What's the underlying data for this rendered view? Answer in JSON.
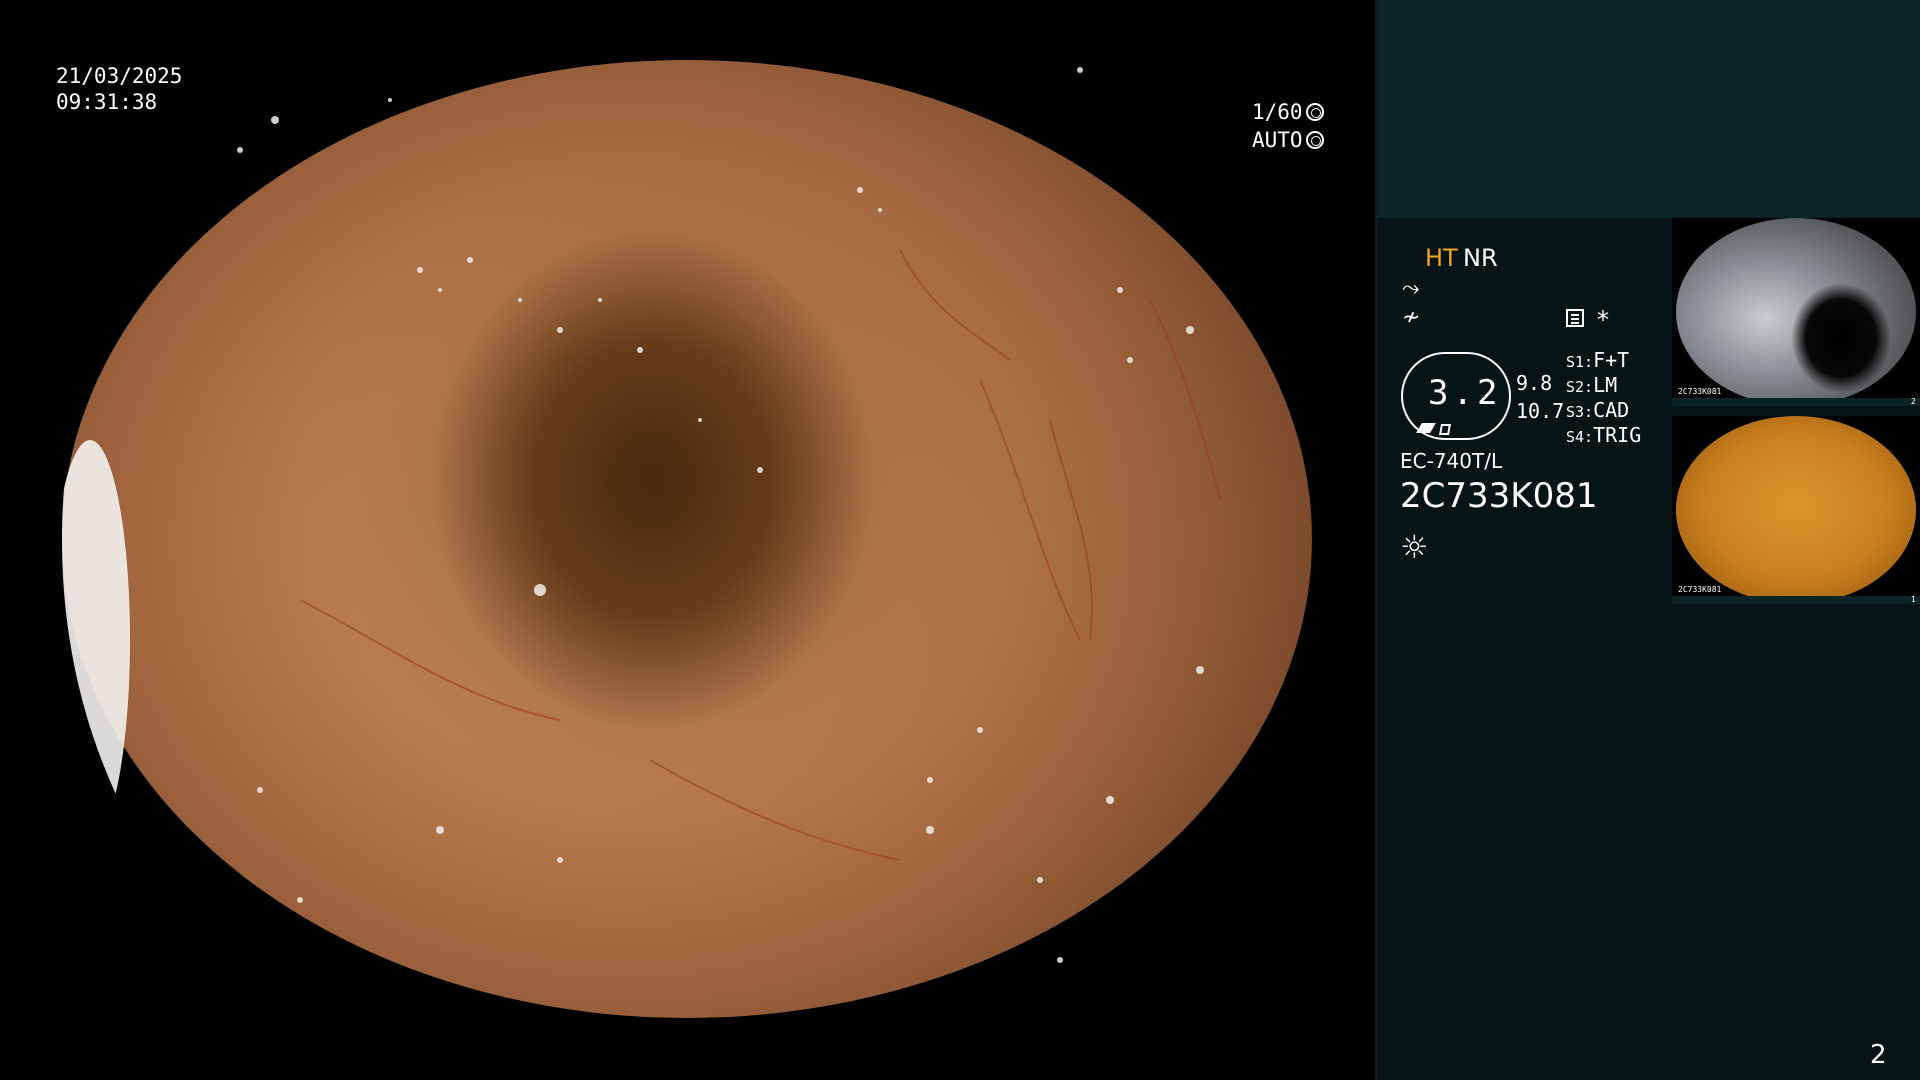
{
  "overlay": {
    "date": "21/03/2025",
    "time": "09:31:38",
    "shutter": "1/60",
    "agc": "AUTO"
  },
  "panel": {
    "ht_label": "HT",
    "nr_label": "NR",
    "star": "*",
    "zoom_value": "3.2",
    "value1": "9.8",
    "value2": "10.7",
    "switches": [
      {
        "key": "S1:",
        "value": "F+T"
      },
      {
        "key": "S2:",
        "value": "LM"
      },
      {
        "key": "S3:",
        "value": "CAD"
      },
      {
        "key": "S4:",
        "value": "TRIG"
      }
    ],
    "scope_model": "EC-740T/L",
    "scope_serial": "2C733K081",
    "icons": {
      "wave1": "enhance-icon",
      "wave2": "filter-icon",
      "menu": "menu-icon",
      "light": "light-icon"
    }
  },
  "thumbnails": [
    {
      "caption": "2C733K081",
      "number": "2"
    },
    {
      "caption": "2C733K081",
      "number": "1"
    }
  ],
  "page_number": "2",
  "colors": {
    "accent_orange": "#f5a623",
    "panel_bg": "#061416",
    "panel_top_bg": "#0d2427"
  }
}
